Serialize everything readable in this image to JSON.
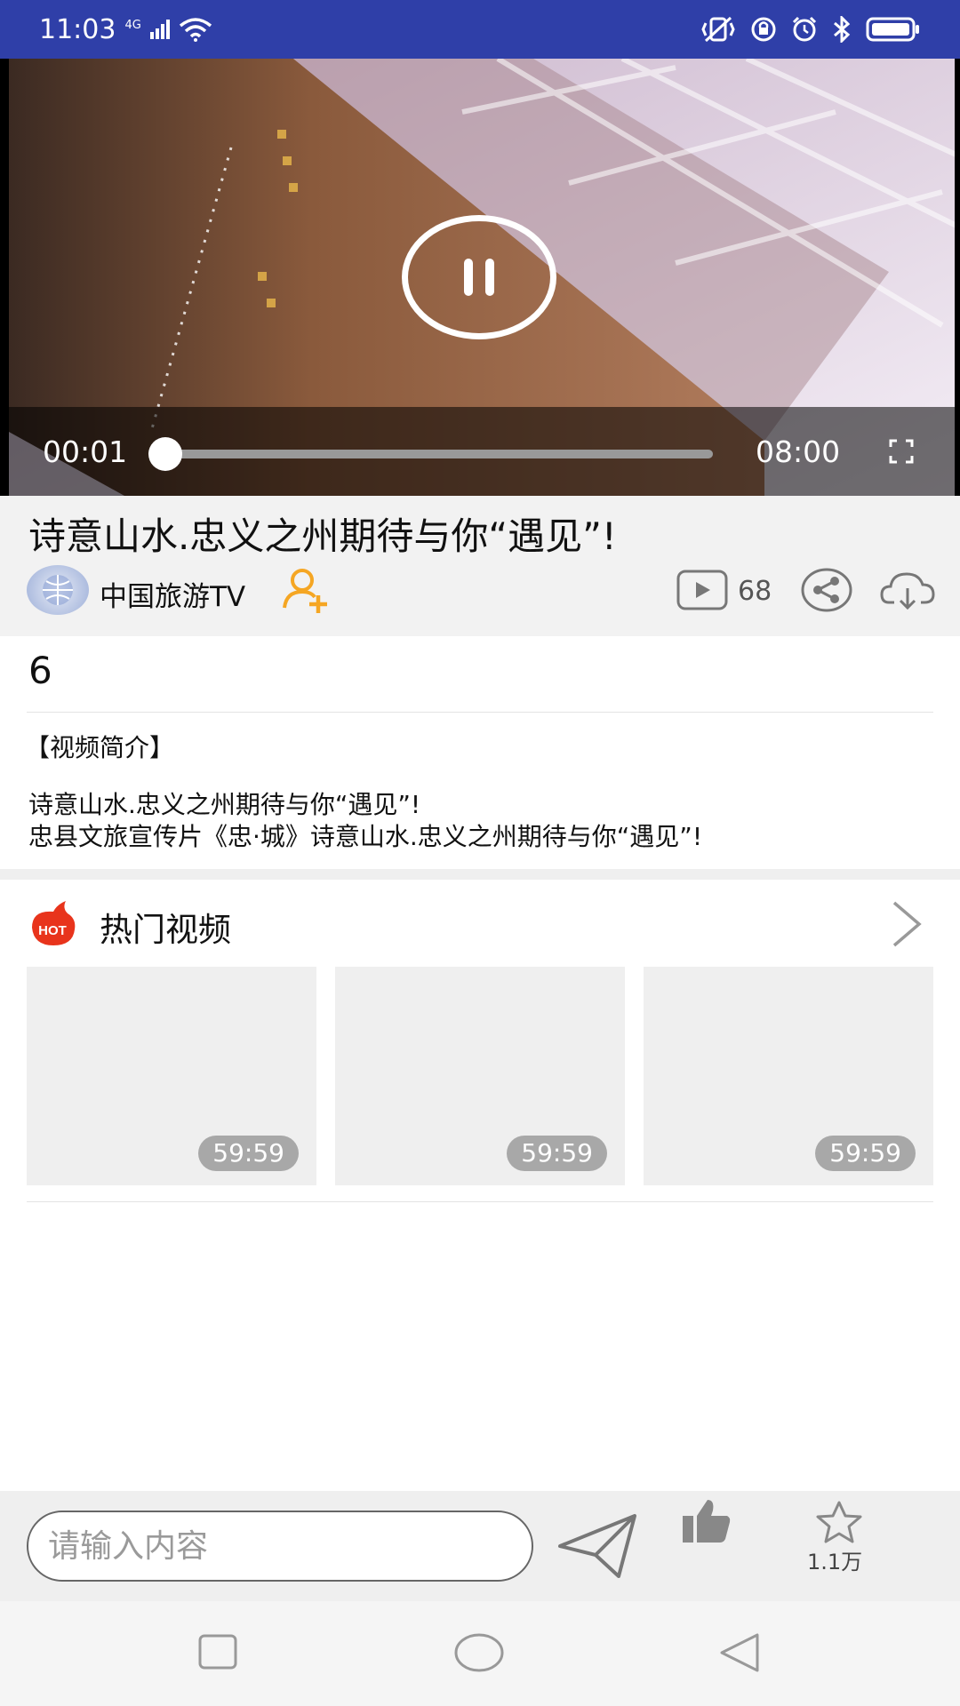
{
  "status_bar": {
    "time": "11:03",
    "network": "4G"
  },
  "player": {
    "current_time": "00:01",
    "duration": "08:00",
    "progress_fraction": 0.003
  },
  "video": {
    "title": "诗意山水.忠义之州期待与你“遇见”!",
    "channel_name": "中国旅游TV",
    "play_count": "68"
  },
  "description": {
    "count": "6",
    "label": "【视频简介】",
    "line1": "诗意山水.忠义之州期待与你“遇见”!",
    "line2": "忠县文旅宣传片《忠·城》诗意山水.忠义之州期待与你“遇见”!"
  },
  "hot": {
    "badge": "HOT",
    "title": "热门视频",
    "items": [
      {
        "duration": "59:59"
      },
      {
        "duration": "59:59"
      },
      {
        "duration": "59:59"
      }
    ]
  },
  "input_bar": {
    "placeholder": "请输入内容",
    "fav_count": "1.1万"
  },
  "colors": {
    "status_bar": "#2f3fa8",
    "accent_orange": "#f5a623",
    "hot_red": "#e8341c"
  }
}
